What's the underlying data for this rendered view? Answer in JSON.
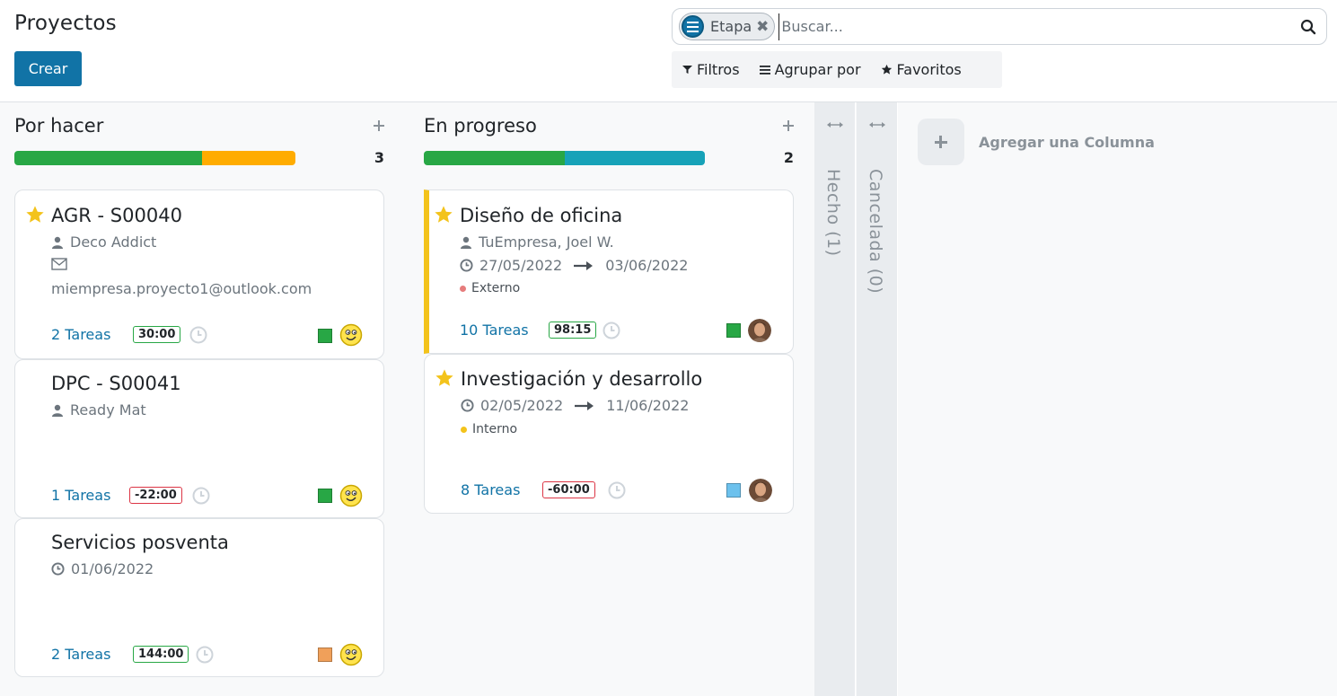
{
  "page": {
    "title": "Proyectos",
    "create_label": "Crear"
  },
  "search": {
    "facet_value": "Etapa",
    "facet_remove": "✖",
    "placeholder": "Buscar..."
  },
  "filters": {
    "filters_label": "Filtros",
    "group_by_label": "Agrupar por",
    "favorites_label": "Favoritos"
  },
  "colors": {
    "primary": "#1173a6",
    "star": "#f3c31b",
    "progress_green": "#28a745",
    "progress_orange": "#ffac00",
    "progress_teal": "#17a2b8",
    "status_green": "#28a745",
    "status_orange": "#f0a05a",
    "status_blue": "#6cc1ed"
  },
  "columns": [
    {
      "title": "Por hacer",
      "count": "3",
      "progress": [
        {
          "color": "#28a745",
          "fraction": 0.667
        },
        {
          "color": "#ffac00",
          "fraction": 0.333
        }
      ],
      "cards": [
        {
          "title": "AGR - S00040",
          "starred": true,
          "customer": "Deco Addict",
          "email": "miempresa.proyecto1@outlook.com",
          "tasks": "2 Tareas",
          "hours": "30:00",
          "hours_state": "ok",
          "status_icon": "status-green",
          "avatar_icon": "smiley-avatar-icon"
        },
        {
          "title": "DPC - S00041",
          "starred": false,
          "customer": "Ready Mat",
          "tasks": "1 Tareas",
          "hours": "-22:00",
          "hours_state": "bad",
          "status_icon": "status-green",
          "avatar_icon": "smiley-avatar-icon"
        },
        {
          "title": "Servicios posventa",
          "starred": false,
          "date": "01/06/2022",
          "tasks": "2 Tareas",
          "hours": "144:00",
          "hours_state": "ok",
          "status_icon": "status-orange",
          "avatar_icon": "smiley-avatar-icon"
        }
      ]
    },
    {
      "title": "En progreso",
      "count": "2",
      "progress": [
        {
          "color": "#28a745",
          "fraction": 0.5
        },
        {
          "color": "#17a2b8",
          "fraction": 0.5
        }
      ],
      "cards": [
        {
          "title": "Diseño de oficina",
          "starred": true,
          "customer": "TuEmpresa, Joel W.",
          "date_start": "27/05/2022",
          "date_end": "03/06/2022",
          "tag": "Externo",
          "tag_color": "#e67c7c",
          "tasks": "10 Tareas",
          "hours": "98:15",
          "hours_state": "ok",
          "status_icon": "status-green",
          "avatar_icon": "user-photo-avatar-icon"
        },
        {
          "title": "Investigación y desarrollo",
          "starred": true,
          "date_start": "02/05/2022",
          "date_end": "11/06/2022",
          "tag": "Interno",
          "tag_color": "#f3c31b",
          "tasks": "8 Tareas",
          "hours": "-60:00",
          "hours_state": "bad",
          "status_icon": "status-blue",
          "avatar_icon": "user-photo-avatar-icon"
        }
      ]
    }
  ],
  "folded_columns": [
    {
      "title": "Hecho (1)"
    },
    {
      "title": "Cancelada (0)"
    }
  ],
  "add_column_label": "Agregar una Columna"
}
